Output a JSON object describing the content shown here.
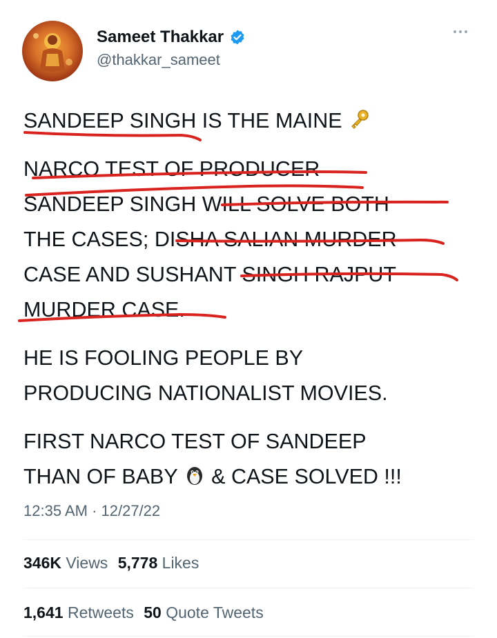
{
  "author": {
    "name": "Sameet Thakkar",
    "handle": "@thakkar_sameet",
    "verified_icon": "verified-badge-icon",
    "avatar_icon": "deity-avatar-image"
  },
  "menu": {
    "icon": "more-options-icon"
  },
  "tweet": {
    "lines_p1": "SANDEEP SINGH IS THE MAINE",
    "p1_emoji": "key-emoji",
    "p2": "NARCO TEST OF PRODUCER\nSANDEEP SINGH WILL SOLVE BOTH\nTHE CASES; DISHA SALIAN MURDER\nCASE AND SUSHANT SINGH RAJPUT\nMURDER CASE.",
    "p3": "HE IS FOOLING PEOPLE BY\nPRODUCING NATIONALIST MOVIES.",
    "p4_line1": "FIRST NARCO TEST OF SANDEEP",
    "p4_line2_a": "THAN OF BABY",
    "p4_emoji": "penguin-emoji",
    "p4_line2_b": "& CASE SOLVED !!!"
  },
  "timestamp": "12:35 AM · 12/27/22",
  "stats_row1": {
    "views_count": "346K",
    "views_label": "Views",
    "likes_count": "5,778",
    "likes_label": "Likes"
  },
  "stats_row2": {
    "retweets_count": "1,641",
    "retweets_label": "Retweets",
    "quotes_count": "50",
    "quotes_label": "Quote Tweets"
  },
  "colors": {
    "text": "#0f1419",
    "secondary": "#536471",
    "verified": "#1d9bf0",
    "annotation_red": "#d8231f"
  }
}
